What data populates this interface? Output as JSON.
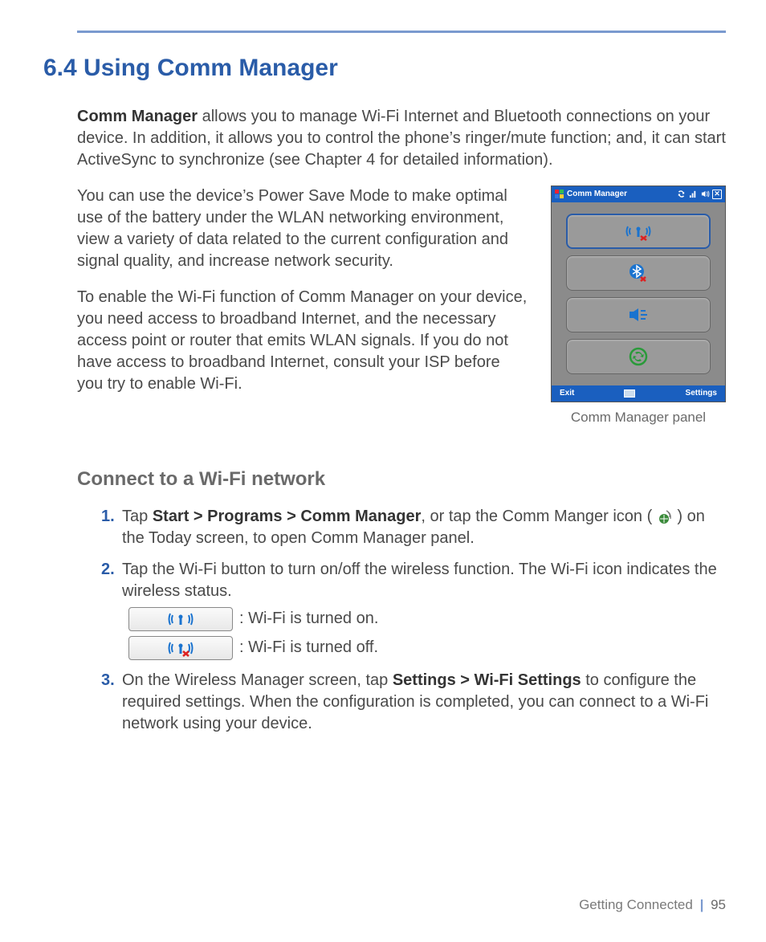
{
  "section_title": "6.4  Using Comm Manager",
  "intro_1_lead": "Comm Manager",
  "intro_1_rest": " allows you to manage Wi-Fi Internet and Bluetooth connections on your device. In addition, it allows you to control the phone’s ringer/mute function; and, it can start ActiveSync to synchronize (see Chapter 4 for detailed information).",
  "intro_2": "You can use the device’s Power Save Mode to make optimal use of the battery under the WLAN networking environment, view a variety of data related to the current configuration and signal quality, and increase network security.",
  "intro_3": "To enable the Wi-Fi function of Comm Manager on your device, you need access to broadband Internet, and the necessary access point or router that emits WLAN signals. If you do not have access to broadband Internet, consult your ISP before you try to enable Wi-Fi.",
  "panel": {
    "title": "Comm Manager",
    "bottom_left": "Exit",
    "bottom_right": "Settings",
    "caption": "Comm Manager panel"
  },
  "subhead": "Connect to a Wi-Fi network",
  "steps": {
    "s1_num": "1.",
    "s1_a": "Tap ",
    "s1_b_bold": "Start > Programs > Comm Manager",
    "s1_c": ", or tap the Comm Manger icon ( ",
    "s1_d": " ) on the Today screen, to open Comm Manager panel.",
    "s2_num": "2.",
    "s2": "Tap the Wi-Fi button to turn on/off the wireless function. The Wi-Fi icon indicates the wireless status.",
    "status_on": ": Wi-Fi is turned on.",
    "status_off": ": Wi-Fi is turned off.",
    "s3_num": "3.",
    "s3_a": "On the Wireless Manager screen, tap ",
    "s3_b_bold": "Settings > Wi-Fi Settings",
    "s3_c": " to configure the required settings. When the configuration is completed, you can connect to a Wi-Fi network using your device."
  },
  "footer": {
    "chapter": "Getting Connected",
    "page": "95"
  }
}
